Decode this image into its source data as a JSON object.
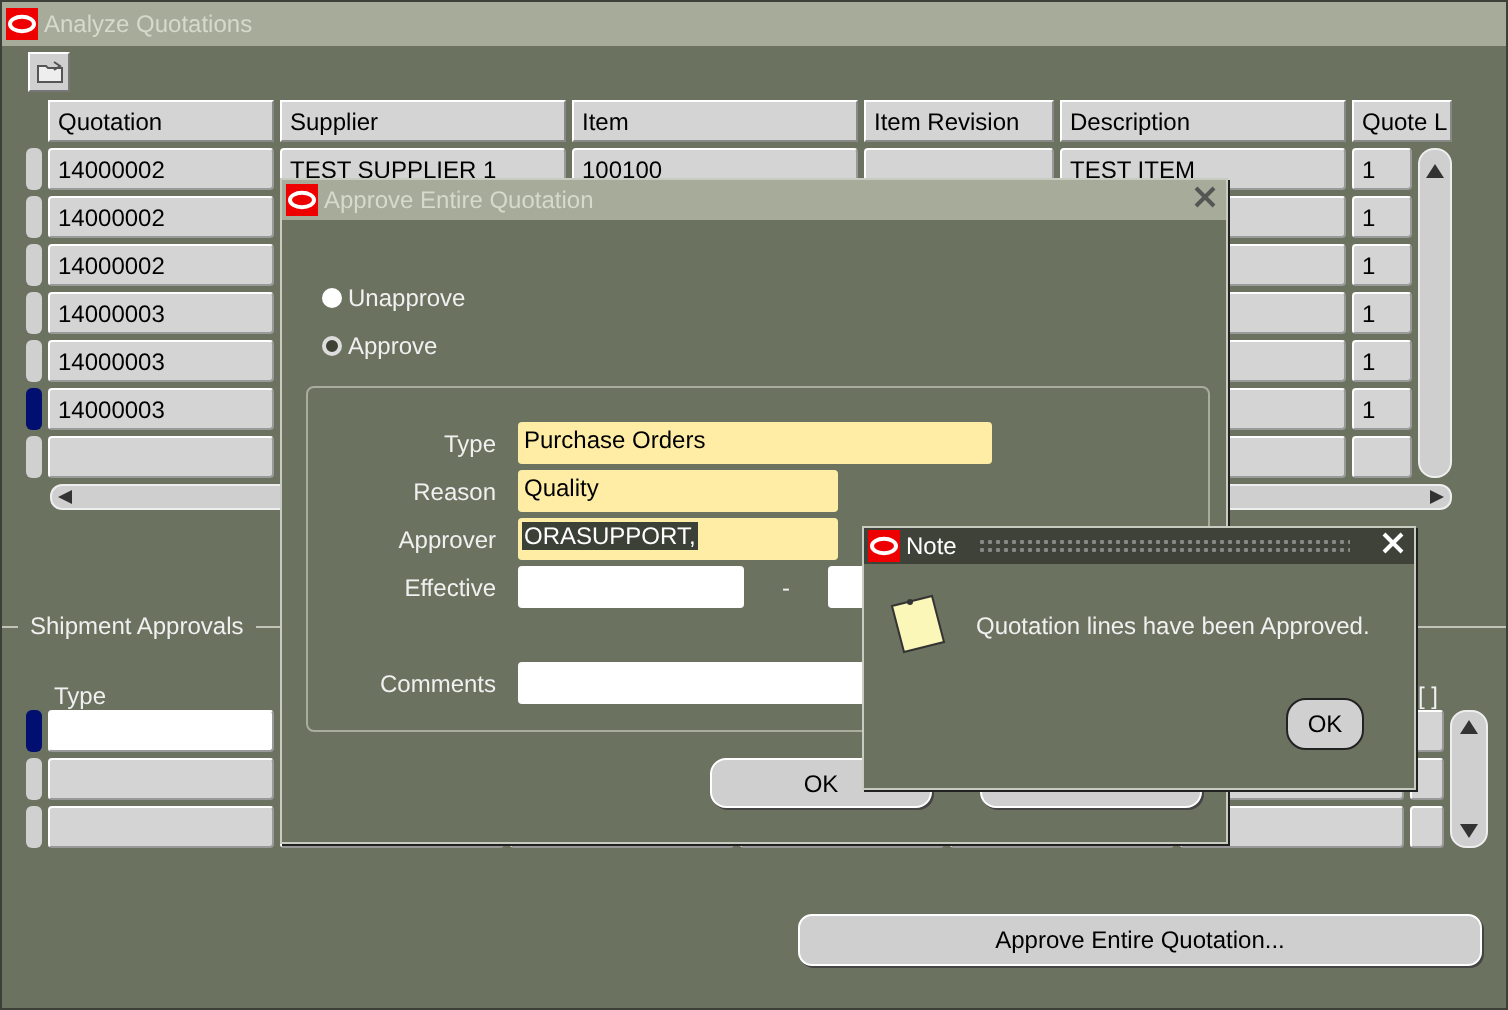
{
  "window": {
    "title": "Analyze Quotations"
  },
  "lines_table": {
    "columns": [
      "Quotation",
      "Supplier",
      "Item",
      "Item Revision",
      "Description",
      "Quote L"
    ],
    "rows": [
      {
        "current": false,
        "quotation": "14000002",
        "supplier": "TEST SUPPLIER 1",
        "item": "100100",
        "description": "TEST ITEM",
        "quote_line": "1"
      },
      {
        "current": false,
        "quotation": "14000002",
        "quote_line": "1"
      },
      {
        "current": false,
        "quotation": "14000002",
        "quote_line": "1"
      },
      {
        "current": false,
        "quotation": "14000003",
        "quote_line": "1"
      },
      {
        "current": false,
        "quotation": "14000003",
        "quote_line": "1"
      },
      {
        "current": true,
        "quotation": "14000003",
        "quote_line": "1"
      },
      {
        "current": false
      }
    ]
  },
  "shipment_approvals": {
    "title": "Shipment Approvals",
    "type_header": "Type",
    "column_7_header": "[ ]",
    "rows": [
      {
        "current": true
      },
      {
        "current": false
      },
      {
        "current": false
      }
    ]
  },
  "approve_button": "Approve Entire Quotation...",
  "approve_dialog": {
    "title": "Approve Entire Quotation",
    "options": [
      {
        "label": "Unapprove",
        "selected": false
      },
      {
        "label": "Approve",
        "selected": true
      }
    ],
    "fields": [
      {
        "label": "Type",
        "value": "Purchase Orders",
        "required": true,
        "highlighted": false
      },
      {
        "label": "Reason",
        "value": "Quality",
        "required": true,
        "highlighted": false
      },
      {
        "label": "Approver",
        "value": "ORASUPPORT,",
        "required": true,
        "highlighted": true
      }
    ],
    "effective": {
      "label": "Effective",
      "separator": "-"
    },
    "comments": {
      "label": "Comments"
    },
    "ok_button": "OK"
  },
  "note": {
    "title": "Note",
    "message": "Quotation lines have been Approved.",
    "ok_button": "OK"
  }
}
